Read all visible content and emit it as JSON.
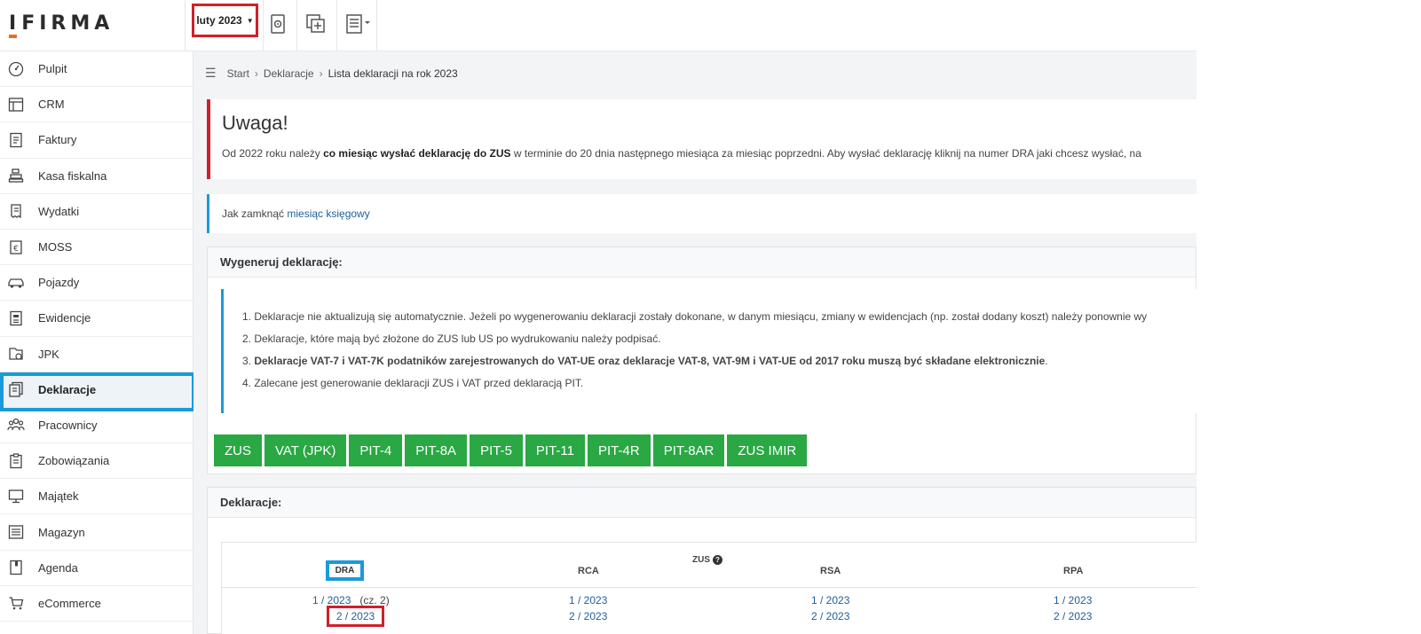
{
  "header": {
    "logo_i": "I",
    "logo_rest": "FIRMA",
    "month": "luty 2023"
  },
  "sidebar": {
    "items": [
      {
        "label": "Pulpit",
        "icon": "dashboard-icon"
      },
      {
        "label": "CRM",
        "icon": "crm-icon"
      },
      {
        "label": "Faktury",
        "icon": "invoice-icon"
      },
      {
        "label": "Kasa fiskalna",
        "icon": "cash-register-icon"
      },
      {
        "label": "Wydatki",
        "icon": "receipt-icon"
      },
      {
        "label": "MOSS",
        "icon": "euro-icon"
      },
      {
        "label": "Pojazdy",
        "icon": "car-icon"
      },
      {
        "label": "Ewidencje",
        "icon": "records-icon"
      },
      {
        "label": "JPK",
        "icon": "jpk-icon"
      },
      {
        "label": "Deklaracje",
        "icon": "declarations-icon",
        "active": true
      },
      {
        "label": "Pracownicy",
        "icon": "employees-icon"
      },
      {
        "label": "Zobowiązania",
        "icon": "clipboard-icon"
      },
      {
        "label": "Majątek",
        "icon": "monitor-icon"
      },
      {
        "label": "Magazyn",
        "icon": "warehouse-icon"
      },
      {
        "label": "Agenda",
        "icon": "agenda-icon"
      },
      {
        "label": "eCommerce",
        "icon": "cart-icon"
      }
    ]
  },
  "breadcrumb": {
    "items": [
      "Start",
      "Deklaracje"
    ],
    "current": "Lista deklaracji na rok 2023"
  },
  "warning": {
    "title": "Uwaga!",
    "text_pre": "Od 2022 roku należy ",
    "text_bold": "co miesiąc wysłać deklarację do ZUS",
    "text_post": " w terminie do 20 dnia następnego miesiąca za miesiąc poprzedni. Aby wysłać deklarację kliknij na numer DRA jaki chcesz wysłać, na"
  },
  "info": {
    "text": "Jak zamknąć ",
    "link": "miesiąc księgowy"
  },
  "generate": {
    "title": "Wygeneruj deklarację:",
    "notes": [
      "1. Deklaracje nie aktualizują się automatycznie. Jeżeli po wygenerowaniu deklaracji zostały dokonane, w danym miesiącu, zmiany w ewidencjach (np. został dodany koszt) należy ponownie wy",
      "2. Deklaracje, które mają być złożone do ZUS lub US po wydrukowaniu należy podpisać.",
      "4. Zalecane jest generowanie deklaracji ZUS i VAT przed deklaracją PIT."
    ],
    "note3_pre": "3. ",
    "note3_bold": "Deklaracje VAT-7 i VAT-7K podatników zarejestrowanych do VAT-UE oraz deklaracje VAT-8, VAT-9M i VAT-UE od 2017 roku muszą być składane elektronicznie",
    "note3_post": ".",
    "buttons": [
      "ZUS",
      "VAT (JPK)",
      "PIT-4",
      "PIT-8A",
      "PIT-5",
      "PIT-11",
      "PIT-4R",
      "PIT-8AR",
      "ZUS IMIR"
    ]
  },
  "declarations": {
    "title": "Deklaracje:",
    "group": "ZUS",
    "columns": [
      "DRA",
      "RCA",
      "RSA",
      "RPA"
    ],
    "dra": [
      "1 / 2023",
      "2 / 2023"
    ],
    "dra_note": "(cz. 2)",
    "rca": [
      "1 / 2023",
      "2 / 2023"
    ],
    "rsa": [
      "1 / 2023",
      "2 / 2023"
    ],
    "rpa": [
      "1 / 2023",
      "2 / 2023"
    ]
  }
}
